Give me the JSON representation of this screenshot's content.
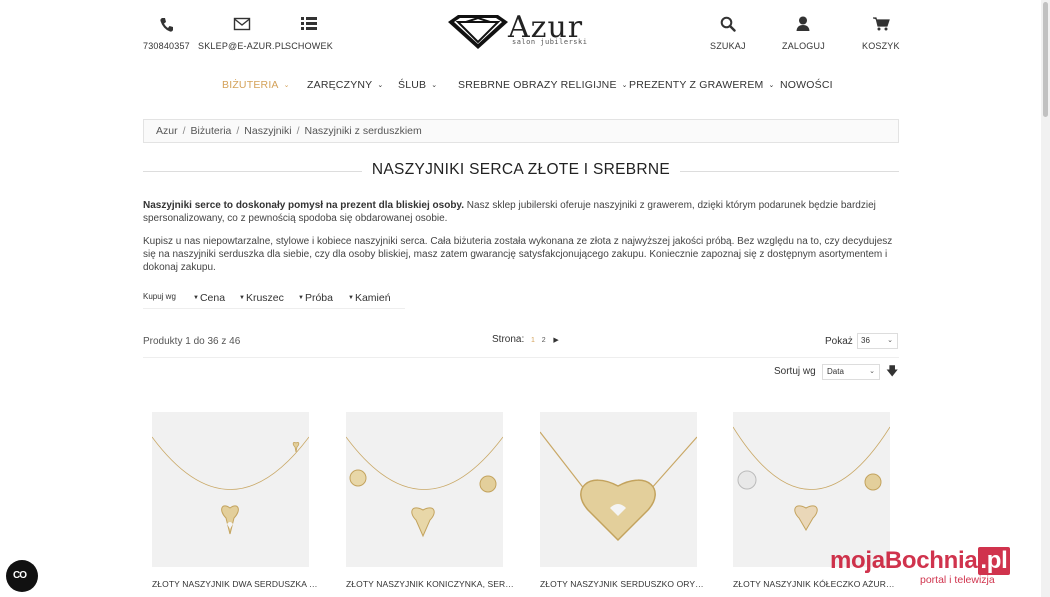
{
  "header": {
    "phone": {
      "icon": "phone-icon",
      "label": "730840357"
    },
    "email": {
      "icon": "envelope-icon",
      "label": "SKLEP@E-AZUR.PL"
    },
    "wishlist": {
      "icon": "list-icon",
      "label": "SCHOWEK"
    },
    "logo": {
      "text": "Azur",
      "subtitle": "salon jubilerski"
    },
    "search": {
      "icon": "search-icon",
      "label": "SZUKAJ"
    },
    "login": {
      "icon": "user-icon",
      "label": "ZALOGUJ"
    },
    "cart": {
      "icon": "cart-icon",
      "label": "KOSZYK"
    }
  },
  "nav": {
    "items": [
      {
        "label": "BIŻUTERIA",
        "active": true,
        "dropdown": true
      },
      {
        "label": "ZARĘCZYNY",
        "dropdown": true
      },
      {
        "label": "ŚLUB",
        "dropdown": true
      },
      {
        "label": "SREBRNE OBRAZY RELIGIJNE",
        "dropdown": true
      },
      {
        "label": "PREZENTY Z GRAWEREM",
        "dropdown": true
      },
      {
        "label": "NOWOŚCI",
        "dropdown": false
      }
    ],
    "accent_color": "#d4a25a"
  },
  "breadcrumb": [
    "Azur",
    "Biżuteria",
    "Naszyjniki",
    "Naszyjniki z serduszkiem"
  ],
  "page": {
    "title": "NASZYJNIKI SERCA ZŁOTE I SREBRNE",
    "desc1_bold": "Naszyjniki serce to doskonały pomysł na prezent dla bliskiej osoby.",
    "desc1_rest": " Nasz sklep jubilerski oferuje naszyjniki z grawerem, dzięki którym podarunek będzie bardziej spersonalizowany, co z pewnością spodoba się obdarowanej osobie.",
    "desc2": "Kupisz u nas niepowtarzalne, stylowe i kobiece naszyjniki serca. Cała biżuteria została wykonana ze złota z najwyższej jakości próbą. Bez względu na to, czy decydujesz się na naszyjniki serduszka dla siebie, czy dla osoby bliskiej, masz zatem gwarancję satysfakcjonującego zakupu. Koniecznie zapoznaj się z dostępnym asortymentem i dokonaj zakupu."
  },
  "filters": {
    "label": "Kupuj wg",
    "items": [
      "Cena",
      "Kruszec",
      "Próba",
      "Kamień"
    ]
  },
  "toolbar": {
    "product_count": "Produkty 1 do 36 z 46",
    "pager_label": "Strona:",
    "pages": [
      "1",
      "2"
    ],
    "current_page": "1",
    "show_label": "Pokaż",
    "show_value": "36",
    "sort_label": "Sortuj wg",
    "sort_value": "Data"
  },
  "products": [
    {
      "name": "ZŁOTY NASZYJNIK DWA SERDUSZKA CELEBRYTKA"
    },
    {
      "name": "ZŁOTY NASZYJNIK KONICZYNKA, SERDUSZKO"
    },
    {
      "name": "ZŁOTY NASZYJNIK SERDUSZKO ORYGINALNE"
    },
    {
      "name": "ZŁOTY NASZYJNIK KÓŁECZKO AŻUROWE"
    }
  ],
  "watermark": {
    "main": "mojaBochnia",
    "tld": ".pl",
    "sub": "portal i telewizja",
    "color": "#c8102e"
  },
  "chat": {
    "label": "CO"
  }
}
